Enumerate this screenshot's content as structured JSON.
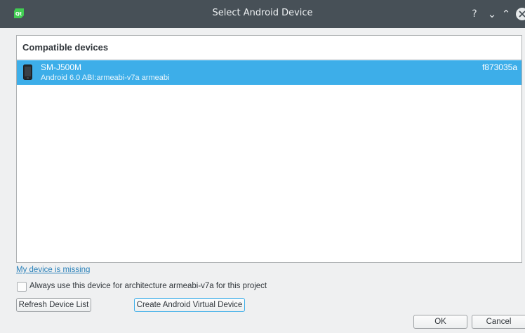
{
  "window": {
    "title": "Select Android Device",
    "help_label": "?",
    "minimize_label": "⌄",
    "maximize_label": "⌃"
  },
  "devices": {
    "header": "Compatible devices",
    "items": [
      {
        "name": "SM-J500M",
        "info": "Android 6.0  ABI:armeabi-v7a armeabi",
        "serial": "f873035a"
      }
    ]
  },
  "missing_link": "My device is missing",
  "always_use": {
    "label": "Always use this device for architecture armeabi-v7a for this project",
    "checked": false
  },
  "buttons": {
    "refresh": "Refresh Device List",
    "create_avd": "Create Android Virtual Device",
    "ok": "OK",
    "cancel": "Cancel"
  },
  "colors": {
    "titlebar": "#475057",
    "selection": "#3daee9",
    "link": "#2980b9",
    "qt_logo": "#41cd52"
  }
}
